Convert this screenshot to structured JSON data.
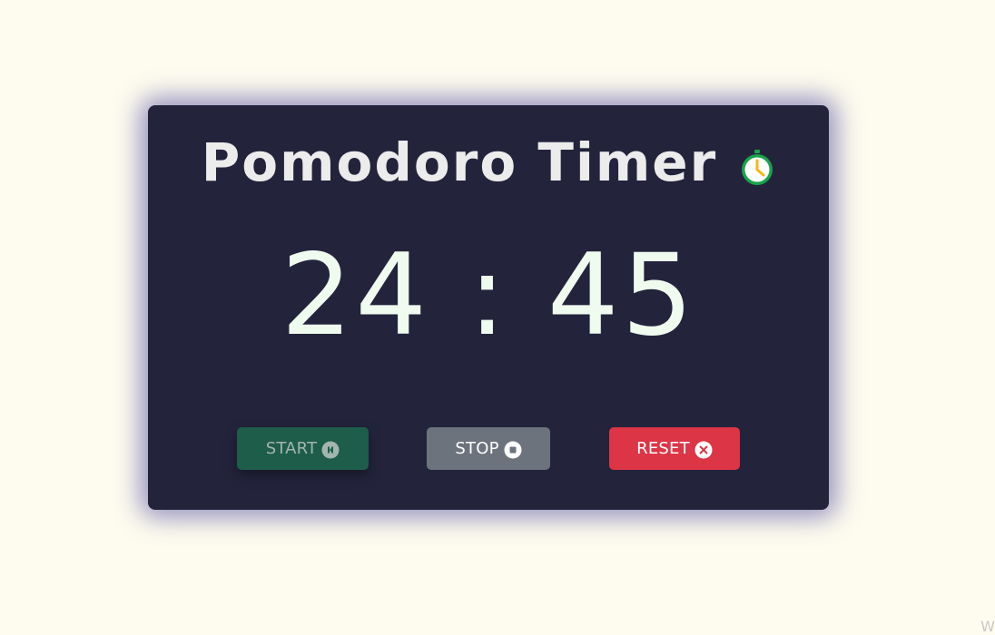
{
  "app": {
    "title": "Pomodoro Timer",
    "title_icon": "stopwatch-icon"
  },
  "timer": {
    "display": "24 : 45",
    "minutes": "24",
    "seconds": "45"
  },
  "controls": {
    "start": {
      "label": "START",
      "icon": "pause-circle-icon",
      "color": "#1d5d49"
    },
    "stop": {
      "label": "STOP",
      "icon": "stop-circle-icon",
      "color": "#6c737c"
    },
    "reset": {
      "label": "RESET",
      "icon": "close-circle-icon",
      "color": "#dc3546"
    }
  },
  "colors": {
    "background": "#fefcef",
    "card": "#23233c",
    "timer_text": "#f0fbef",
    "stopwatch_ring": "#1aa34a",
    "stopwatch_hand": "#f5b70f"
  },
  "corner_text": "Wi"
}
